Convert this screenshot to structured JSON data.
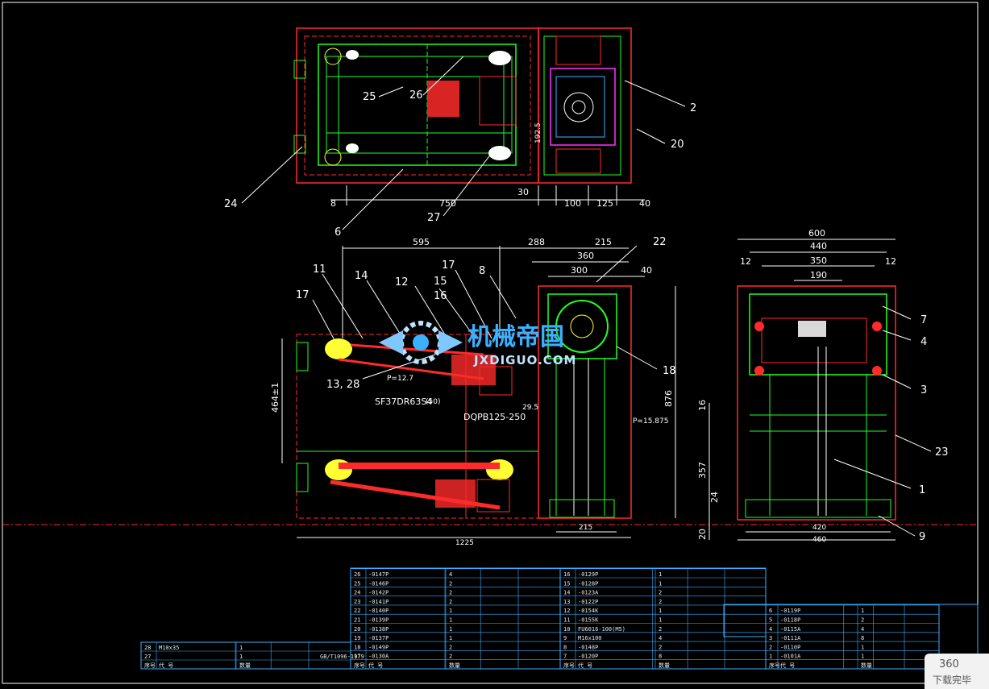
{
  "colors": {
    "background": "#000000",
    "frame": "#ffffff",
    "part_green": "#22ff22",
    "part_red": "#ff2a2a",
    "part_yellow": "#ffff33",
    "part_magenta": "#ff33ff",
    "dimension": "#ffffff",
    "watermark": "#3bb0ff"
  },
  "top_view": {
    "dims": [
      "8",
      "750",
      "30",
      "100",
      "125",
      "40",
      "192.5"
    ],
    "callouts": [
      "25",
      "26",
      "2",
      "20",
      "24",
      "6",
      "27"
    ]
  },
  "front_view": {
    "dims": [
      "595",
      "288",
      "215",
      "360",
      "300",
      "40",
      "464±1",
      "876",
      "1225",
      "215",
      "20",
      "29.5"
    ],
    "callouts": [
      "11",
      "17",
      "14",
      "12",
      "15",
      "16",
      "17",
      "8",
      "22",
      "13, 28",
      "18"
    ],
    "notes": [
      "P=12.7",
      "SF37DR63S4",
      "(50)",
      "DQPB125-250",
      "P=15.875"
    ]
  },
  "side_view": {
    "dims": [
      "600",
      "440",
      "12",
      "350",
      "12",
      "190",
      "16",
      "357",
      "24",
      "20",
      "420",
      "460"
    ],
    "callouts": [
      "7",
      "4",
      "3",
      "23",
      "1",
      "9"
    ]
  },
  "watermark": {
    "title": "机械帝国",
    "url": "JXDIGUO.COM"
  },
  "bom_left": [
    {
      "no": "28",
      "code": "M10x35",
      "qty": "1"
    },
    {
      "no": "27",
      "code": "",
      "qty": "1",
      "std": "GB/T1096-1979"
    },
    {
      "no": "序号",
      "code": "代 号",
      "qty": "数量"
    }
  ],
  "bom_mid": [
    {
      "no": "26",
      "code": "-0147P",
      "qty": "4"
    },
    {
      "no": "25",
      "code": "-0146P",
      "qty": "2"
    },
    {
      "no": "24",
      "code": "-0142P",
      "qty": "2"
    },
    {
      "no": "23",
      "code": "-0141P",
      "qty": "2"
    },
    {
      "no": "22",
      "code": "-0140P",
      "qty": "1"
    },
    {
      "no": "21",
      "code": "-0139P",
      "qty": "1"
    },
    {
      "no": "20",
      "code": "-0138P",
      "qty": "1"
    },
    {
      "no": "19",
      "code": "-0137P",
      "qty": "1"
    },
    {
      "no": "18",
      "code": "-0149P",
      "qty": "2"
    },
    {
      "no": "17",
      "code": "-0130A",
      "qty": "2"
    },
    {
      "no": "序号",
      "code": "代 号",
      "qty": "数量"
    }
  ],
  "bom_right": [
    {
      "no": "16",
      "code": "-0129P",
      "qty": "1"
    },
    {
      "no": "15",
      "code": "-0128P",
      "qty": "1"
    },
    {
      "no": "14",
      "code": "-0123A",
      "qty": "2"
    },
    {
      "no": "13",
      "code": "-0122P",
      "qty": "2"
    },
    {
      "no": "12",
      "code": "-0154K",
      "qty": "1"
    },
    {
      "no": "11",
      "code": "-0155K",
      "qty": "1"
    },
    {
      "no": "10",
      "code": "FU6016-100(M5)",
      "qty": "2"
    },
    {
      "no": "9",
      "code": "M16x100",
      "qty": "4"
    },
    {
      "no": "8",
      "code": "-0148P",
      "qty": "2"
    },
    {
      "no": "7",
      "code": "-0120P",
      "qty": "8"
    },
    {
      "no": "序号",
      "code": "代 号",
      "qty": "数量"
    }
  ],
  "bom_far": [
    {
      "no": "6",
      "code": "-0119P",
      "qty": "1"
    },
    {
      "no": "5",
      "code": "-0118P",
      "qty": "2"
    },
    {
      "no": "4",
      "code": "-0115A",
      "qty": "4"
    },
    {
      "no": "3",
      "code": "-0111A",
      "qty": "8"
    },
    {
      "no": "2",
      "code": "-0110P",
      "qty": "1"
    },
    {
      "no": "1",
      "code": "-0101A",
      "qty": "1"
    },
    {
      "no": "序号",
      "code": "代 号",
      "qty": "数量"
    }
  ],
  "badge": {
    "line1": "360",
    "line2": "下载完毕"
  }
}
